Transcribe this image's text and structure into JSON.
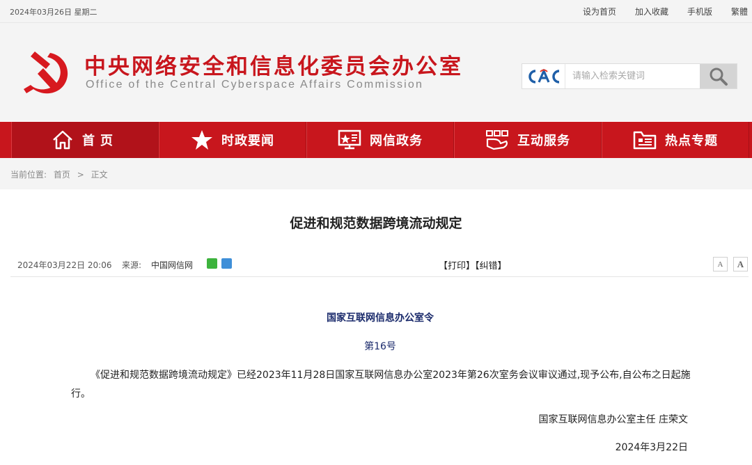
{
  "topbar": {
    "date": "2024年03月26日 星期二",
    "links": [
      "设为首页",
      "加入收藏",
      "手机版",
      "繁體"
    ]
  },
  "header": {
    "title_cn": "中央网络安全和信息化委员会办公室",
    "title_en": "Office of the Central Cyberspace Affairs Commission",
    "logo_text": "CAC",
    "search_placeholder": "请输入检索关键词"
  },
  "nav": {
    "items": [
      {
        "label": "首页",
        "icon": "home-icon"
      },
      {
        "label": "时政要闻",
        "icon": "star-icon"
      },
      {
        "label": "网信政务",
        "icon": "government-icon"
      },
      {
        "label": "互动服务",
        "icon": "interaction-icon"
      },
      {
        "label": "热点专题",
        "icon": "folder-icon"
      }
    ]
  },
  "breadcrumb": {
    "label": "当前位置:",
    "home": "首页",
    "sep": ">",
    "current": "正文"
  },
  "article": {
    "title": "促进和规范数据跨境流动规定",
    "time": "2024年03月22日 20:06",
    "source_label": "来源:",
    "source": "中国网信网",
    "print": "【打印】",
    "correct": "【纠错】",
    "font_small": "A",
    "font_large": "A",
    "decree_title": "国家互联网信息办公室令",
    "decree_no": "第16号",
    "body": "《促进和规范数据跨境流动规定》已经2023年11月28日国家互联网信息办公室2023年第26次室务会议审议通过,现予公布,自公布之日起施行。",
    "signature": "国家互联网信息办公室主任 庄荣文",
    "sign_date": "2024年3月22日"
  },
  "colors": {
    "brand_red": "#c8161d",
    "decree_blue": "#1a2a6b",
    "cac_blue": "#1f5fa8"
  }
}
